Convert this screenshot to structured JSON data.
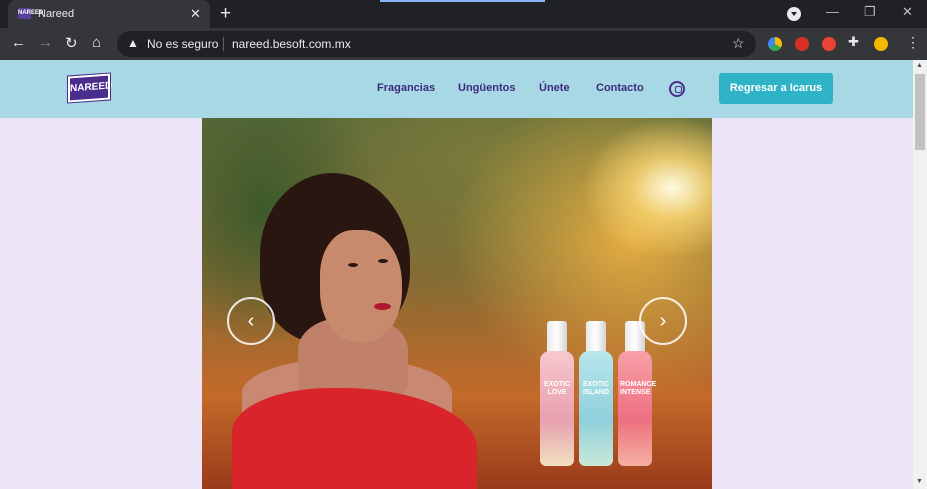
{
  "browser": {
    "tab": {
      "title": "Nareed",
      "favicon_text": "NAREED"
    },
    "new_tab_label": "+",
    "address": {
      "security_label": "No es seguro",
      "url": "nareed.besoft.com.mx"
    },
    "icons": [
      "back-icon",
      "forward-icon",
      "reload-icon",
      "home-icon",
      "warning-icon",
      "star-icon",
      "extensions-icon",
      "menu-icon"
    ]
  },
  "site": {
    "logo_text": "NAREED",
    "nav": [
      "Fragancias",
      "Ungüentos",
      "Únete",
      "Contacto"
    ],
    "cta_label": "Regresar a Icarus"
  },
  "carousel": {
    "products": [
      "EXOTIC LOVE",
      "EXOTIC ISLAND",
      "ROMANCE INTENSE"
    ],
    "prev_label": "‹",
    "next_label": "›"
  },
  "colors": {
    "navbar": "#a8d8e6",
    "page_bg": "#ede5f7",
    "brand_purple": "#4a2d8c",
    "cta": "#2fb3c6"
  }
}
